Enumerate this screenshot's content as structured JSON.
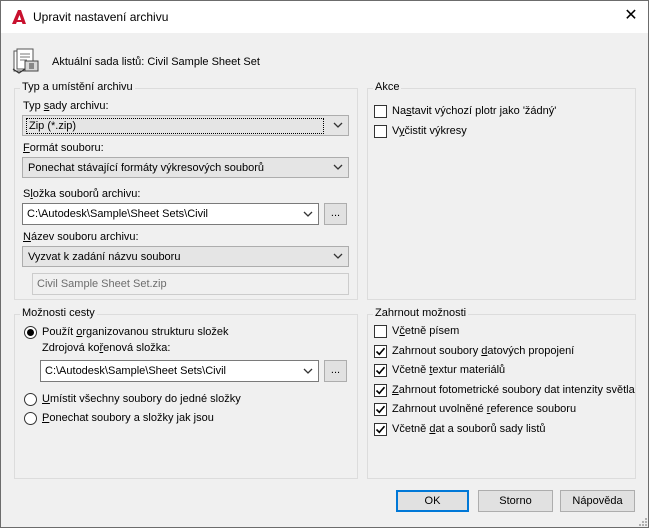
{
  "window": {
    "title": "Upravit nastavení archivu",
    "close_label": "✕"
  },
  "header": {
    "current_set_label": "Aktuální sada listů: Civil Sample Sheet Set"
  },
  "archive_type_group": {
    "label": "Typ a umístění archivu",
    "type_label_pre": "Typ ",
    "type_label_u": "s",
    "type_label_post": "ady archivu:",
    "type_value": "Zip (*.zip)",
    "format_label_pre": "",
    "format_label_u": "F",
    "format_label_post": "ormát souboru:",
    "format_value": "Ponechat stávající formáty výkresových souborů",
    "folder_label_pre": "S",
    "folder_label_u": "l",
    "folder_label_post": "ožka souborů archivu:",
    "folder_value": "C:\\Autodesk\\Sample\\Sheet Sets\\Civil",
    "folder_browse_label": "...",
    "name_label_pre": "",
    "name_label_u": "N",
    "name_label_post": "ázev souboru archivu:",
    "name_value": "Vyzvat k zadání názvu souboru",
    "filename_value": "Civil Sample Sheet Set.zip"
  },
  "actions_group": {
    "label": "Akce",
    "items": [
      {
        "pre": "Na",
        "u": "s",
        "post": "tavit výchozí plotr jako 'žádný'",
        "checked": false
      },
      {
        "pre": "V",
        "u": "y",
        "post": "čistit výkresy",
        "checked": false
      }
    ]
  },
  "path_group": {
    "label": "Možnosti cesty",
    "opt_organized_pre": "Použít ",
    "opt_organized_u": "o",
    "opt_organized_post": "rganizovanou strukturu složek",
    "source_label_pre": "Zdrojová ko",
    "source_label_u": "ř",
    "source_label_post": "enová složka:",
    "source_value": "C:\\Autodesk\\Sample\\Sheet Sets\\Civil",
    "source_browse_label": "...",
    "opt_single_pre": "",
    "opt_single_u": "U",
    "opt_single_post": "místit všechny soubory do jedné složky",
    "opt_keep_pre": "",
    "opt_keep_u": "P",
    "opt_keep_post": "onechat soubory a složky jak jsou",
    "selected": "organized"
  },
  "include_group": {
    "label": "Zahrnout možnosti",
    "items": [
      {
        "pre": "V",
        "u": "č",
        "post": "etně písem",
        "checked": false
      },
      {
        "pre": "Zahrnout soubory ",
        "u": "d",
        "post": "atových propojení",
        "checked": true
      },
      {
        "pre": "Včetně ",
        "u": "t",
        "post": "extur materiálů",
        "checked": true
      },
      {
        "pre": "",
        "u": "Z",
        "post": "ahrnout fotometrické soubory dat intenzity světla",
        "checked": true
      },
      {
        "pre": "Zahrnout uvolněné ",
        "u": "r",
        "post": "eference souboru",
        "checked": true
      },
      {
        "pre": "Včetně ",
        "u": "d",
        "post": "at a souborů sady listů",
        "checked": true
      }
    ]
  },
  "buttons": {
    "ok": "OK",
    "cancel": "Storno",
    "help": "Nápověda"
  },
  "colors": {
    "accent": "#0078d7",
    "autocad_red": "#c8102e"
  }
}
